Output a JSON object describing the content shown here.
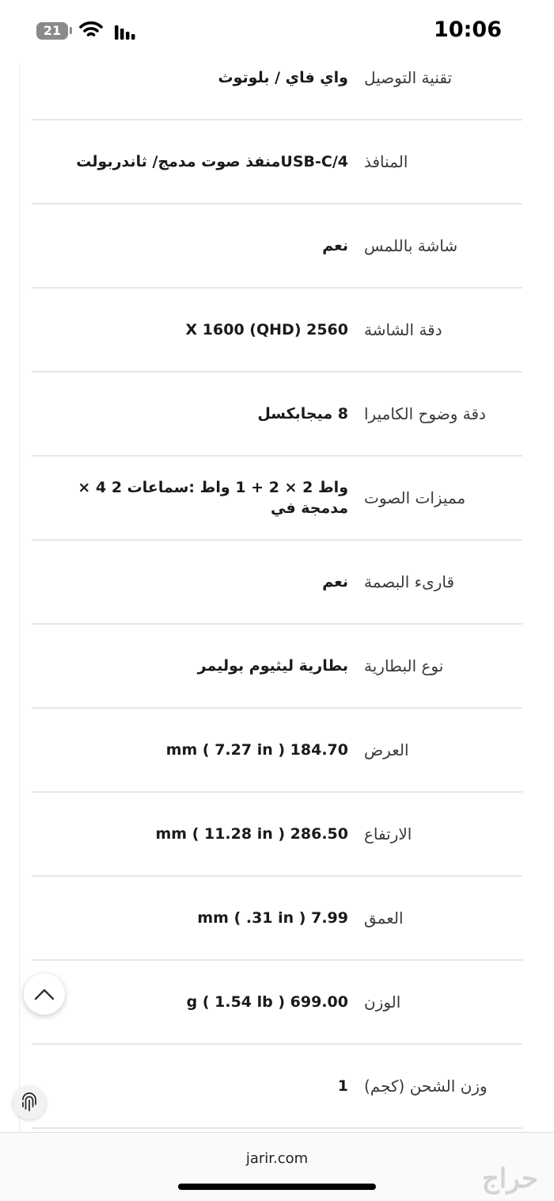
{
  "status_bar": {
    "time": "10:06",
    "battery": "21"
  },
  "specs": [
    {
      "label": "تقنية التوصيل",
      "value": "واي فاي / بلوتوث"
    },
    {
      "label": "المنافذ",
      "value": "USB-C/4منفذ صوت مدمج/ ثاندربولت"
    },
    {
      "label": "شاشة باللمس",
      "value": "نعم"
    },
    {
      "label": "دقة الشاشة",
      "value": "X 1600 (QHD) 2560"
    },
    {
      "label": "دقة وضوح الكاميرا",
      "value": "8 ميجابكسل"
    },
    {
      "label": "مميزات الصوت",
      "value": "واط 2 × 2 + 1 واط :سماعات 2 4 × مدمجة في"
    },
    {
      "label": "قارىء البصمة",
      "value": "نعم"
    },
    {
      "label": "نوع البطارية",
      "value": "بطارية ليثيوم بوليمر"
    },
    {
      "label": "العرض",
      "value": "184.70 mm ( 7.27 in )"
    },
    {
      "label": "الارتفاع",
      "value": "286.50 mm ( 11.28 in )"
    },
    {
      "label": "العمق",
      "value": "7.99 mm ( .31 in )"
    },
    {
      "label": "الوزن",
      "value": "699.00 g ( 1.54 lb )"
    },
    {
      "label": "وزن الشحن (كجم)",
      "value": "1"
    }
  ],
  "browser": {
    "domain": "jarir.com"
  },
  "watermark": "حراج"
}
